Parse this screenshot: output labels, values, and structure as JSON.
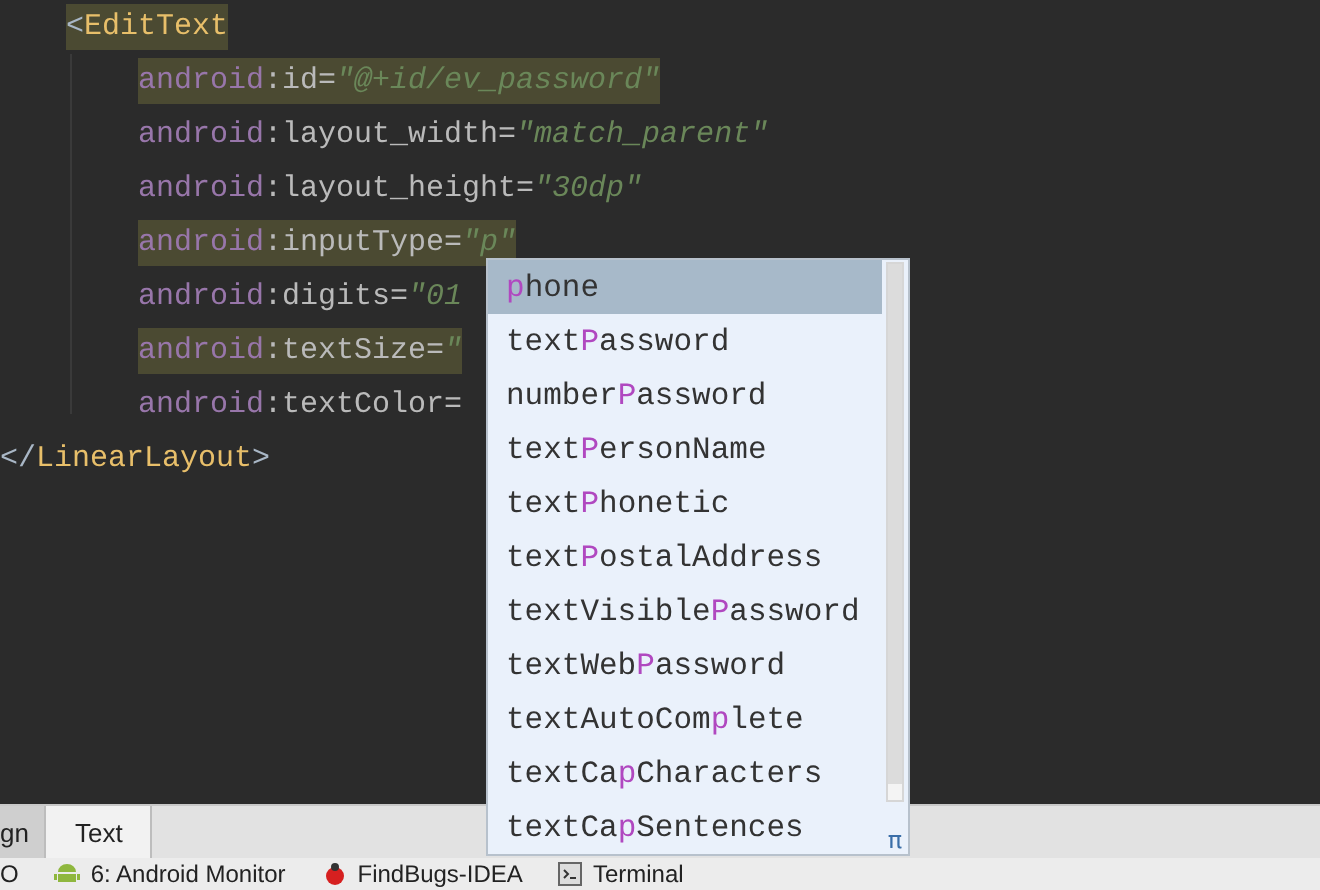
{
  "editor": {
    "lines": [
      {
        "kind": "open",
        "highlighted": true,
        "tokens": [
          {
            "kind": "bracket",
            "text": "<"
          },
          {
            "kind": "tag",
            "text": "EditText"
          }
        ],
        "children": [
          {
            "highlighted": true,
            "tokens": [
              {
                "kind": "ns",
                "text": "android"
              },
              {
                "kind": "attr",
                "text": ":id="
              },
              {
                "kind": "value",
                "text": "\"@+id/ev_password\""
              }
            ]
          },
          {
            "highlighted": false,
            "tokens": [
              {
                "kind": "ns",
                "text": "android"
              },
              {
                "kind": "attr",
                "text": ":layout_width="
              },
              {
                "kind": "value",
                "text": "\"match_parent\""
              }
            ]
          },
          {
            "highlighted": false,
            "tokens": [
              {
                "kind": "ns",
                "text": "android"
              },
              {
                "kind": "attr",
                "text": ":layout_height="
              },
              {
                "kind": "value",
                "text": "\"30dp\""
              }
            ]
          },
          {
            "highlighted": true,
            "tokens": [
              {
                "kind": "ns",
                "text": "android"
              },
              {
                "kind": "attr",
                "text": ":inputType="
              },
              {
                "kind": "value",
                "text": "\"p\""
              }
            ]
          },
          {
            "highlighted": false,
            "tokens": [
              {
                "kind": "ns",
                "text": "android"
              },
              {
                "kind": "attr",
                "text": ":digits="
              },
              {
                "kind": "value",
                "text": "\"01"
              }
            ]
          },
          {
            "highlighted": true,
            "tokens": [
              {
                "kind": "ns",
                "text": "android"
              },
              {
                "kind": "attr",
                "text": ":textSize="
              },
              {
                "kind": "value",
                "text": "\""
              }
            ]
          },
          {
            "highlighted": false,
            "tokens": [
              {
                "kind": "ns",
                "text": "android"
              },
              {
                "kind": "attr",
                "text": ":textColor="
              }
            ]
          }
        ]
      },
      {
        "kind": "close",
        "highlighted": false,
        "tokens": [
          {
            "kind": "bracket",
            "text": "</"
          },
          {
            "kind": "tag",
            "text": "LinearLayout"
          },
          {
            "kind": "bracket",
            "text": ">"
          }
        ]
      }
    ]
  },
  "completion": {
    "items": [
      {
        "match": "p",
        "after": "hone",
        "selected": true
      },
      {
        "before": "text",
        "match": "P",
        "after": "assword",
        "selected": false
      },
      {
        "before": "number",
        "match": "P",
        "after": "assword",
        "selected": false
      },
      {
        "before": "text",
        "match": "P",
        "after": "ersonName",
        "selected": false
      },
      {
        "before": "text",
        "match": "P",
        "after": "honetic",
        "selected": false
      },
      {
        "before": "text",
        "match": "P",
        "after": "ostalAddress",
        "selected": false
      },
      {
        "before": "textVisible",
        "match": "P",
        "after": "assword",
        "selected": false
      },
      {
        "before": "textWeb",
        "match": "P",
        "after": "assword",
        "selected": false
      },
      {
        "before": "textAutoCom",
        "match": "p",
        "after": "lete",
        "selected": false
      },
      {
        "before": "textCa",
        "match": "p",
        "after": "Characters",
        "selected": false
      },
      {
        "before": "textCa",
        "match": "p",
        "after": "Sentences",
        "selected": false
      }
    ],
    "hint": "π"
  },
  "editor_tabs": [
    {
      "label": "gn",
      "selected": false
    },
    {
      "label": "Text",
      "selected": true
    }
  ],
  "tool_windows": [
    {
      "kind": "plain",
      "label": "O"
    },
    {
      "kind": "android",
      "label": "6: Android Monitor"
    },
    {
      "kind": "bug",
      "label": "FindBugs-IDEA"
    },
    {
      "kind": "terminal",
      "label": "Terminal"
    }
  ]
}
